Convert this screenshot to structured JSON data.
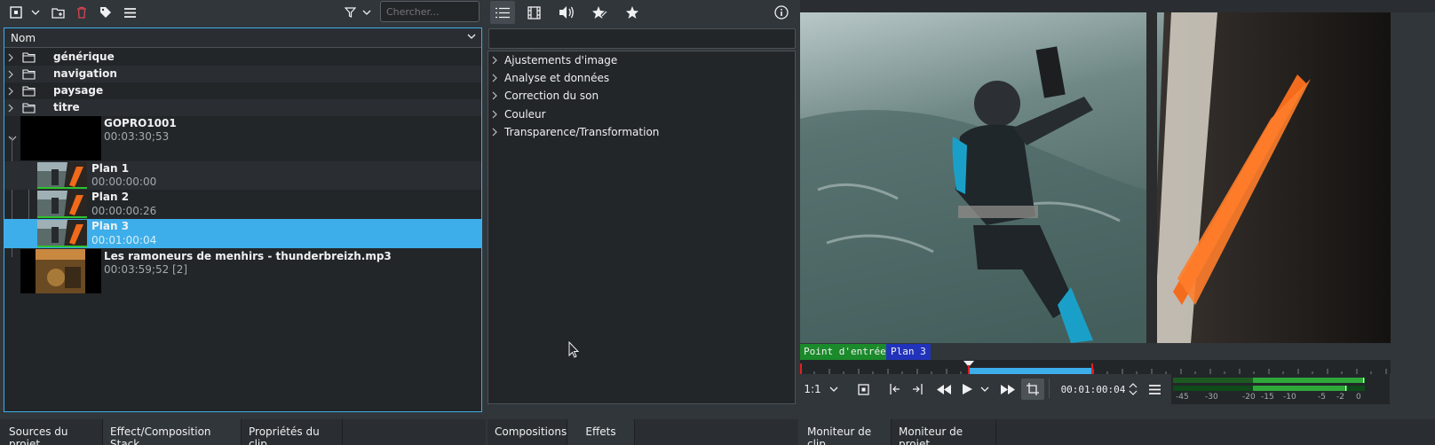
{
  "project_bin": {
    "search_placeholder": "Chercher...",
    "column_header": "Nom",
    "folders": [
      {
        "label": "générique"
      },
      {
        "label": "navigation"
      },
      {
        "label": "paysage"
      },
      {
        "label": "titre"
      }
    ],
    "clips": [
      {
        "title": "GOPRO1001",
        "duration": "00:03:30;53"
      },
      {
        "title": "Plan 1",
        "duration": "00:00:00:00"
      },
      {
        "title": "Plan 2",
        "duration": "00:00:00:26"
      },
      {
        "title": "Plan 3",
        "duration": "00:01:00:04"
      },
      {
        "title": "Les ramoneurs de menhirs - thunderbreizh.mp3",
        "duration": "00:03:59;52 [2]"
      }
    ]
  },
  "left_tabs": [
    "Sources du projet",
    "Effect/Composition Stack",
    "Propriétés du clip"
  ],
  "effects": {
    "categories": [
      "Ajustements d'image",
      "Analyse et données",
      "Correction du son",
      "Couleur",
      "Transparence/Transformation"
    ]
  },
  "mid_tabs": [
    "Compositions",
    "Effets"
  ],
  "monitor": {
    "in_point_label": "Point d'entrée",
    "zone_label": "Plan 3",
    "zoom": "1:1",
    "timecode": "00:01:00:04",
    "audio_scale": [
      "-45",
      "-30",
      "-20",
      "-15",
      "-10",
      "-5",
      "-2",
      "0"
    ]
  },
  "right_tabs": [
    "Moniteur de clip",
    "Moniteur de projet"
  ],
  "colors": {
    "accent": "#3daee9",
    "in_point": "#1a8a2a",
    "zone": "#2233bb",
    "playhead": "#e02020"
  }
}
